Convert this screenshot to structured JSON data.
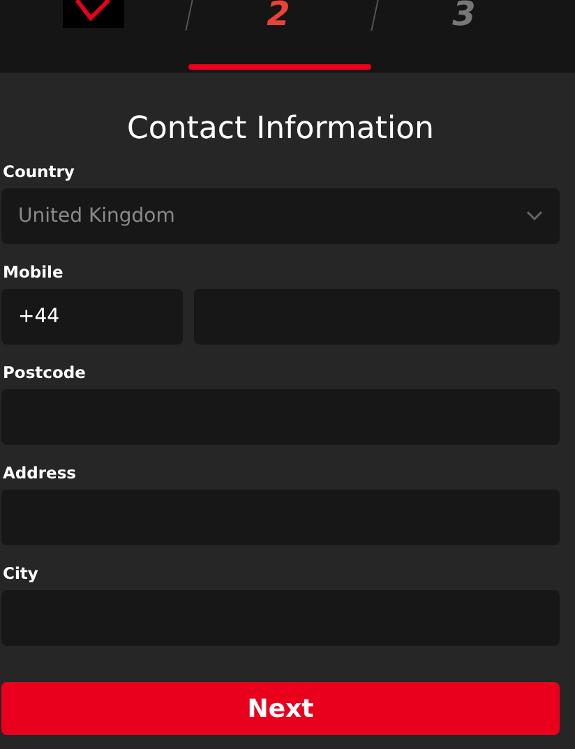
{
  "steps": [
    {
      "kind": "done",
      "selected": false
    },
    {
      "kind": "number",
      "label": "2",
      "selected": true
    },
    {
      "kind": "number",
      "label": "3",
      "selected": false
    }
  ],
  "title": "Contact Information",
  "fields": [
    {
      "kind": "select",
      "label": "Country",
      "value": "United Kingdom"
    },
    {
      "kind": "phone",
      "label": "Mobile",
      "prefix": "+44"
    },
    {
      "kind": "text",
      "label": "Postcode"
    },
    {
      "kind": "text",
      "label": "Address"
    },
    {
      "kind": "text",
      "label": "City"
    }
  ],
  "submit": "Next"
}
